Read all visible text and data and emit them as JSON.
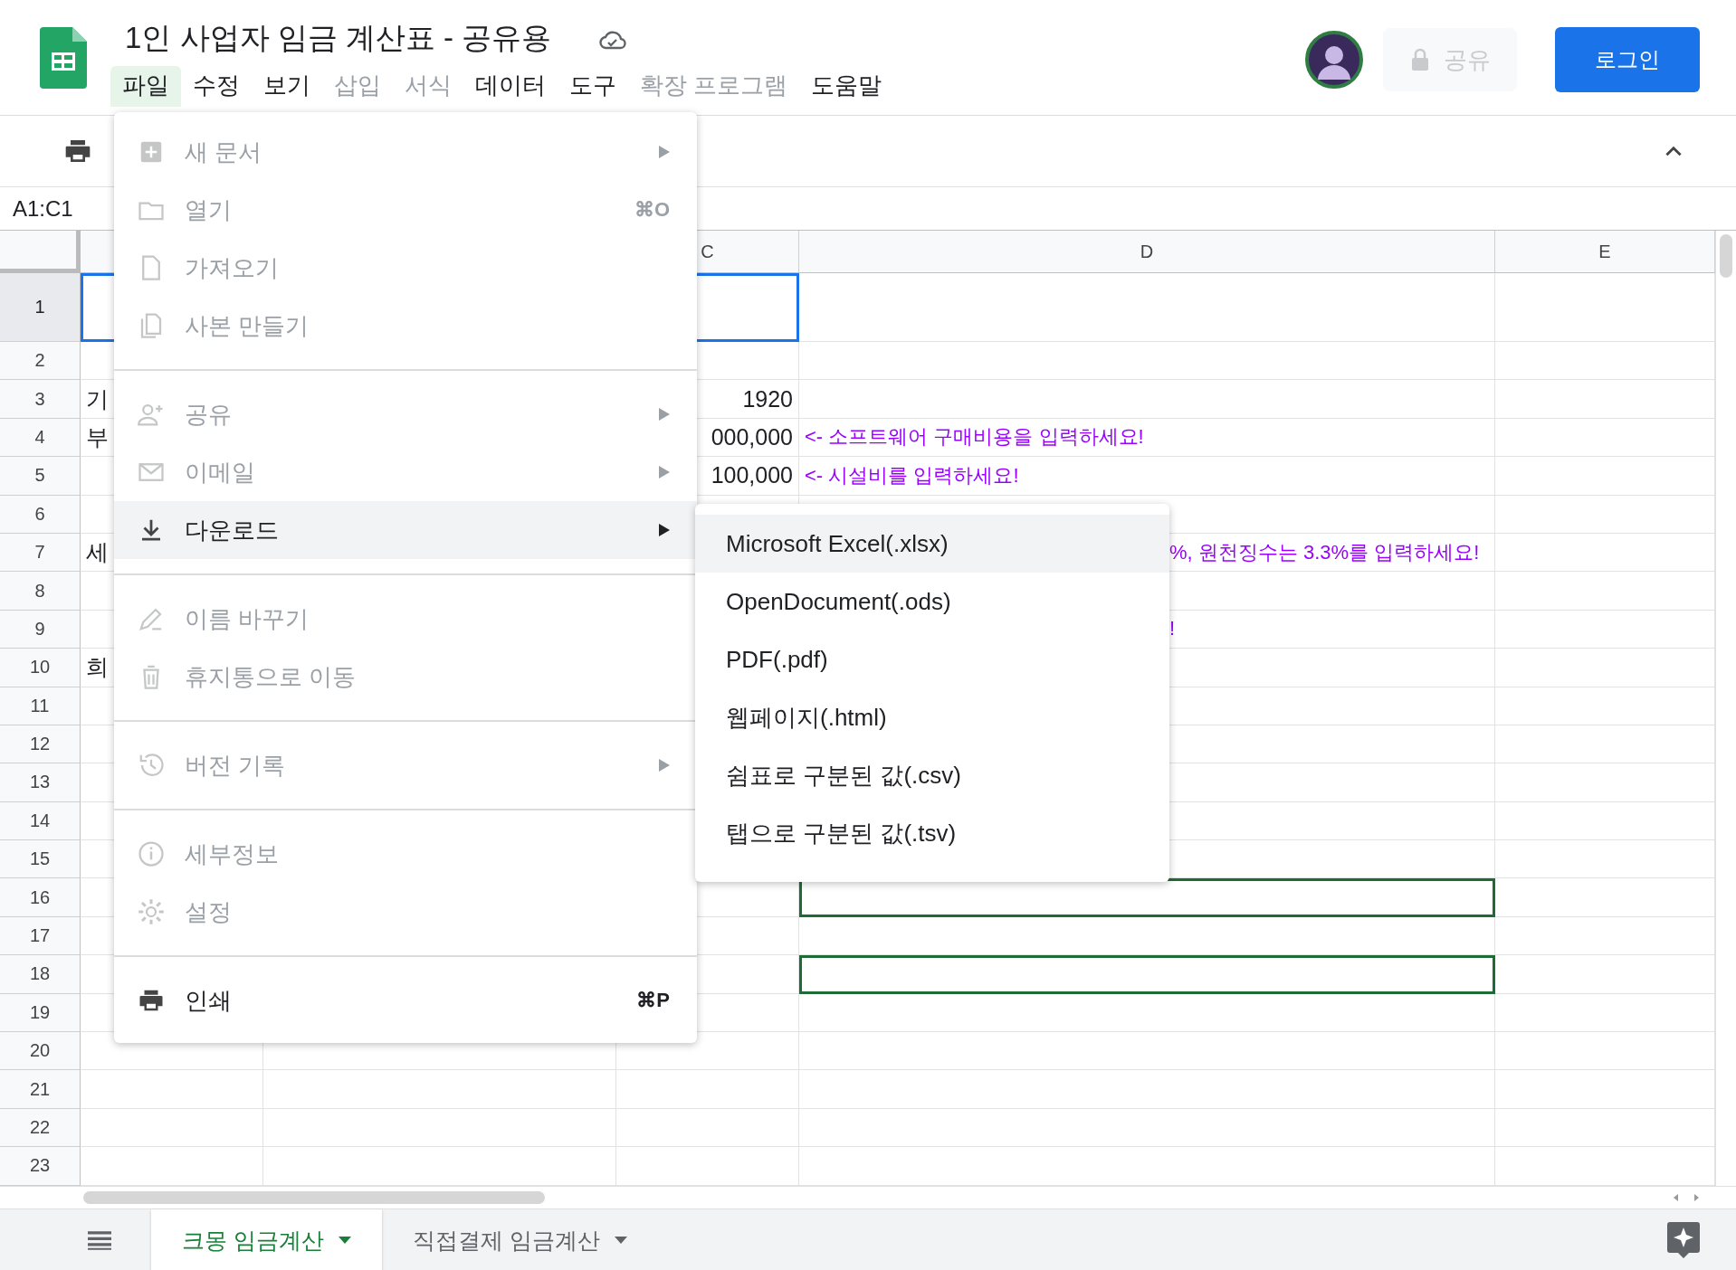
{
  "title": "1인 사업자 임금 계산표 -  공유용",
  "menubar": [
    {
      "label": "파일",
      "selected": true,
      "disabled": false
    },
    {
      "label": "수정",
      "selected": false,
      "disabled": false
    },
    {
      "label": "보기",
      "selected": false,
      "disabled": false
    },
    {
      "label": "삽입",
      "selected": false,
      "disabled": true
    },
    {
      "label": "서식",
      "selected": false,
      "disabled": true
    },
    {
      "label": "데이터",
      "selected": false,
      "disabled": false
    },
    {
      "label": "도구",
      "selected": false,
      "disabled": false
    },
    {
      "label": "확장 프로그램",
      "selected": false,
      "disabled": true
    },
    {
      "label": "도움말",
      "selected": false,
      "disabled": false
    }
  ],
  "share_button": {
    "label": "공유",
    "disabled": true
  },
  "login_button": {
    "label": "로그인"
  },
  "name_box": "A1:C1",
  "column_headers": [
    "C",
    "D",
    "E"
  ],
  "rows": [
    {
      "number": "1",
      "selected": true
    },
    {
      "number": "2",
      "selected": false
    },
    {
      "number": "3",
      "selected": false,
      "col_a": "기",
      "col_c": "1920"
    },
    {
      "number": "4",
      "selected": false,
      "col_a": "부",
      "col_c": "000,000",
      "col_d": "<- 소프트웨어 구매비용을 입력하세요!"
    },
    {
      "number": "5",
      "selected": false,
      "col_c": "100,000",
      "col_d": "<- 시설비를 입력하세요!"
    },
    {
      "number": "6",
      "selected": false
    },
    {
      "number": "7",
      "selected": false,
      "col_a": "세",
      "col_d": "%, 원천징수는 3.3%를 입력하세요!"
    },
    {
      "number": "8",
      "selected": false
    },
    {
      "number": "9",
      "selected": false,
      "col_d": "!"
    },
    {
      "number": "10",
      "selected": false,
      "col_a": "희"
    },
    {
      "number": "11",
      "selected": false
    },
    {
      "number": "12",
      "selected": false
    },
    {
      "number": "13",
      "selected": false
    },
    {
      "number": "14",
      "selected": false
    },
    {
      "number": "15",
      "selected": false
    },
    {
      "number": "16",
      "selected": false,
      "d_outlined": true
    },
    {
      "number": "17",
      "selected": false
    },
    {
      "number": "18",
      "selected": false,
      "d_outlined": true
    },
    {
      "number": "19",
      "selected": false
    },
    {
      "number": "20",
      "selected": false
    },
    {
      "number": "21",
      "selected": false
    },
    {
      "number": "22",
      "selected": false
    },
    {
      "number": "23",
      "selected": false
    }
  ],
  "file_menu": [
    [
      {
        "label": "새 문서",
        "disabled": true,
        "submenu": true,
        "selected": false
      },
      {
        "label": "열기",
        "disabled": true,
        "shortcut": "⌘O",
        "selected": false
      },
      {
        "label": "가져오기",
        "disabled": true,
        "selected": false
      },
      {
        "label": "사본 만들기",
        "disabled": true,
        "selected": false
      }
    ],
    [
      {
        "label": "공유",
        "disabled": true,
        "submenu": true,
        "selected": false
      },
      {
        "label": "이메일",
        "disabled": true,
        "submenu": true,
        "selected": false
      },
      {
        "label": "다운로드",
        "disabled": false,
        "submenu": true,
        "selected": true
      }
    ],
    [
      {
        "label": "이름 바꾸기",
        "disabled": true,
        "selected": false
      },
      {
        "label": "휴지통으로 이동",
        "disabled": true,
        "selected": false
      }
    ],
    [
      {
        "label": "버전 기록",
        "disabled": true,
        "submenu": true,
        "selected": false
      }
    ],
    [
      {
        "label": "세부정보",
        "disabled": true,
        "selected": false
      },
      {
        "label": "설정",
        "disabled": true,
        "selected": false
      }
    ],
    [
      {
        "label": "인쇄",
        "disabled": false,
        "shortcut": "⌘P",
        "selected": false
      }
    ]
  ],
  "download_menu": [
    {
      "label": "Microsoft Excel(.xlsx)",
      "selected": true
    },
    {
      "label": "OpenDocument(.ods)",
      "selected": false
    },
    {
      "label": "PDF(.pdf)",
      "selected": false
    },
    {
      "label": "웹페이지(.html)",
      "selected": false
    },
    {
      "label": "쉼표로 구분된 값(.csv)",
      "selected": false
    },
    {
      "label": "탭으로 구분된 값(.tsv)",
      "selected": false
    }
  ],
  "sheet_tabs": [
    {
      "label": "크몽 임금계산",
      "selected": true
    },
    {
      "label": "직접결제 임금계산",
      "selected": false
    }
  ]
}
